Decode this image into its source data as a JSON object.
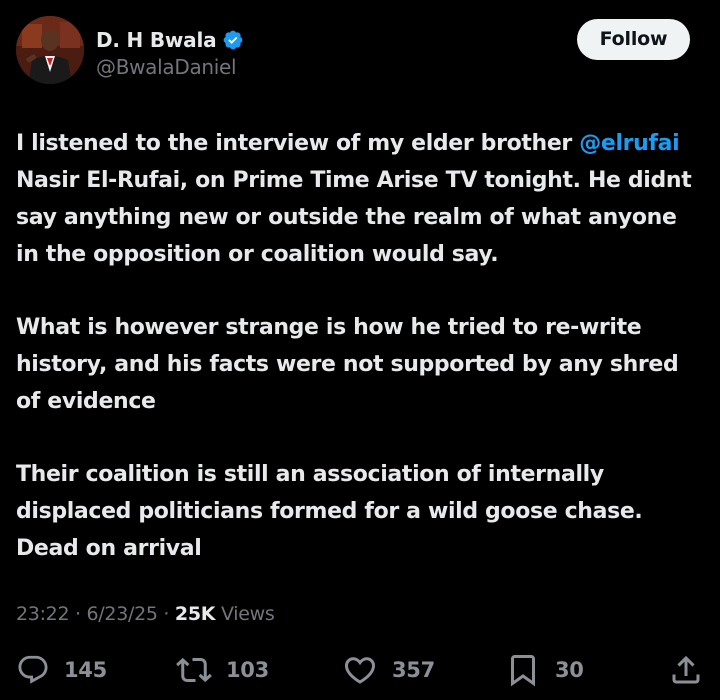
{
  "author": {
    "display_name": "D. H Bwala",
    "handle": "@BwalaDaniel",
    "verified_icon": "verified-badge-icon",
    "avatar_icon": "profile-avatar"
  },
  "follow_button": {
    "label": "Follow"
  },
  "tweet": {
    "paragraphs": [
      {
        "before_mention": "I listened to the interview of my elder brother ",
        "mention": "@elrufai",
        "after_mention": " Nasir El-Rufai, on Prime Time Arise TV tonight. He didnt say anything new or outside the realm of what anyone in the opposition or coalition would say."
      },
      {
        "text": "What is however strange is how he tried to re-write history, and his facts were not supported by any shred of evidence"
      },
      {
        "text": "Their coalition is still an association of internally displaced politicians formed for a wild goose chase. Dead on arrival"
      }
    ]
  },
  "meta": {
    "time": "23:22",
    "separator": "·",
    "date": "6/23/25",
    "views_count": "25K",
    "views_label": "Views"
  },
  "actions": {
    "replies": {
      "icon": "reply-icon",
      "count": "145"
    },
    "reposts": {
      "icon": "repost-icon",
      "count": "103"
    },
    "likes": {
      "icon": "like-icon",
      "count": "357"
    },
    "bookmarks": {
      "icon": "bookmark-icon",
      "count": "30"
    },
    "share": {
      "icon": "share-icon"
    }
  },
  "colors": {
    "background": "#000000",
    "primary_text": "#e7e9ea",
    "secondary_text": "#71767b",
    "link": "#1d9bf0",
    "verified": "#1d9bf0",
    "follow_button_bg": "#eff3f4"
  }
}
